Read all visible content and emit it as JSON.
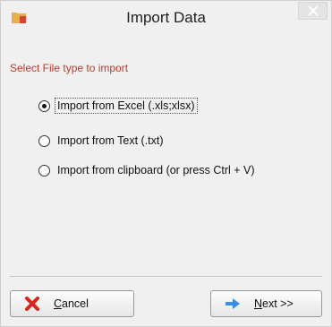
{
  "window": {
    "title": "Import Data"
  },
  "prompt": "Select File type to import",
  "options": [
    {
      "label": "Import from Excel (.xls;xlsx)",
      "selected": true
    },
    {
      "label": "Import from Text (.txt)",
      "selected": false
    },
    {
      "label": "Import from clipboard (or press Ctrl + V)",
      "selected": false
    }
  ],
  "buttons": {
    "cancel": {
      "mnemonic": "C",
      "rest": "ancel"
    },
    "next": {
      "mnemonic": "N",
      "rest": "ext >>"
    }
  },
  "icons": {
    "title": "folder-icon",
    "close": "close-icon",
    "cancel": "red-x-icon",
    "next": "blue-arrow-icon"
  },
  "colors": {
    "prompt": "#c0392b",
    "cancel_icon": "#d9261c",
    "next_icon": "#3a8ee6"
  }
}
